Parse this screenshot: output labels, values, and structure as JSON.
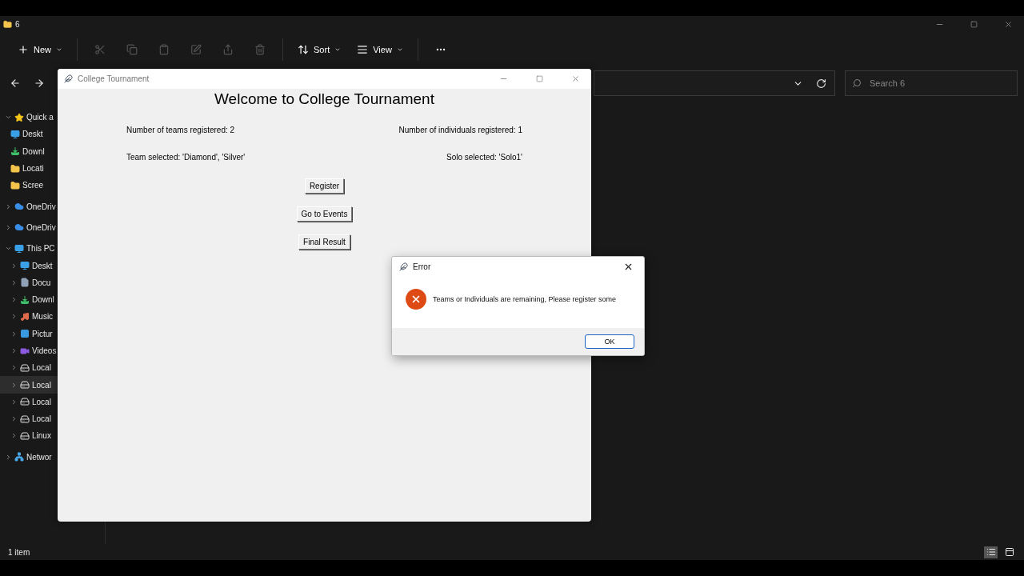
{
  "explorer": {
    "title": "6",
    "toolbar": [
      {
        "kind": "new",
        "label": "New",
        "disabled": false
      },
      {
        "kind": "cut",
        "disabled": true
      },
      {
        "kind": "copy",
        "disabled": true
      },
      {
        "kind": "paste",
        "disabled": true
      },
      {
        "kind": "rename",
        "disabled": true
      },
      {
        "kind": "share",
        "disabled": true
      },
      {
        "kind": "delete",
        "disabled": true
      },
      {
        "kind": "sort",
        "label": "Sort",
        "disabled": false
      },
      {
        "kind": "view",
        "label": "View",
        "disabled": false
      },
      {
        "kind": "more",
        "disabled": false
      }
    ],
    "search": {
      "placeholder": "Search 6"
    },
    "sidebar": [
      {
        "kind": "star",
        "label": "Quick a",
        "expanded": true,
        "selected": false,
        "children": [
          {
            "kind": "desktop",
            "label": "Deskt",
            "selected": false
          },
          {
            "kind": "download",
            "label": "Downl",
            "selected": false
          },
          {
            "kind": "folder",
            "label": "Locati",
            "selected": false
          },
          {
            "kind": "folder",
            "label": "Scree",
            "selected": false
          }
        ]
      },
      {
        "kind": "cloud",
        "label": "OneDriv",
        "expanded": false,
        "selected": false
      },
      {
        "kind": "cloud",
        "label": "OneDriv",
        "expanded": false,
        "selected": false
      },
      {
        "kind": "pc",
        "label": "This PC",
        "expanded": true,
        "selected": false,
        "children": [
          {
            "kind": "desktop",
            "label": "Deskt",
            "expanded": false,
            "selected": false
          },
          {
            "kind": "docs",
            "label": "Docu",
            "expanded": false,
            "selected": false
          },
          {
            "kind": "download",
            "label": "Downl",
            "expanded": false,
            "selected": false
          },
          {
            "kind": "music",
            "label": "Music",
            "expanded": false,
            "selected": false
          },
          {
            "kind": "pictures",
            "label": "Pictur",
            "expanded": false,
            "selected": false
          },
          {
            "kind": "videos",
            "label": "Videos",
            "expanded": false,
            "selected": false
          },
          {
            "kind": "drive",
            "label": "Local",
            "expanded": false,
            "selected": false
          },
          {
            "kind": "drive",
            "label": "Local",
            "expanded": false,
            "selected": true
          },
          {
            "kind": "drive",
            "label": "Local",
            "expanded": false,
            "selected": false
          },
          {
            "kind": "drive",
            "label": "Local",
            "expanded": false,
            "selected": false
          },
          {
            "kind": "drive",
            "label": "Linux",
            "expanded": false,
            "selected": false
          }
        ]
      },
      {
        "kind": "network",
        "label": "Networ",
        "expanded": false,
        "selected": false
      }
    ],
    "status_bar": {
      "text": "1 item",
      "views": [
        {
          "kind": "details",
          "selected": true
        },
        {
          "kind": "tiles",
          "selected": false
        }
      ]
    }
  },
  "app_window": {
    "title": "College Tournament",
    "heading": "Welcome to College Tournament",
    "teams_registered": "Number of teams registered: 2",
    "individuals_registered": "Number of individuals registered: 1",
    "team_selected": "Team selected: 'Diamond', 'Silver'",
    "solo_selected": "Solo selected: 'Solo1'",
    "buttons": [
      "Register",
      "Go to Events",
      "Final Result"
    ]
  },
  "error_dialog": {
    "title": "Error",
    "message": "Teams or Individuals are remaining, Please register some",
    "button": {
      "label": "OK",
      "focused": true
    }
  }
}
